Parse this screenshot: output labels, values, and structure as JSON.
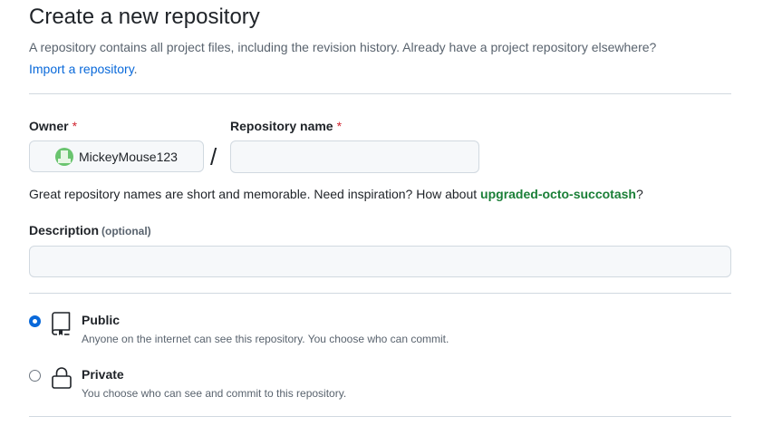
{
  "header": {
    "title": "Create a new repository",
    "subtitle": "A repository contains all project files, including the revision history. Already have a project repository elsewhere?",
    "import_link": "Import a repository",
    "import_after": "."
  },
  "owner": {
    "label": "Owner",
    "required_mark": "*",
    "value": "MickeyMouse123",
    "avatar_icon": "user-avatar-icon"
  },
  "separator": "/",
  "repo_name": {
    "label": "Repository name",
    "required_mark": "*",
    "value": "",
    "placeholder": ""
  },
  "name_hint": {
    "text": "Great repository names are short and memorable. Need inspiration? How about ",
    "suggestion": "upgraded-octo-succotash",
    "suffix": "?"
  },
  "description": {
    "label": "Description",
    "optional": "(optional)",
    "value": "",
    "placeholder": ""
  },
  "visibility": {
    "selected": "public",
    "options": [
      {
        "id": "public",
        "title": "Public",
        "desc": "Anyone on the internet can see this repository. You choose who can commit.",
        "icon": "repo-book-icon",
        "checked": true
      },
      {
        "id": "private",
        "title": "Private",
        "desc": "You choose who can see and commit to this repository.",
        "icon": "lock-icon",
        "checked": false
      }
    ]
  },
  "colors": {
    "link": "#0969da",
    "suggestion": "#1a7f37",
    "required": "#d1242f",
    "radio_checked": "#0969da"
  }
}
